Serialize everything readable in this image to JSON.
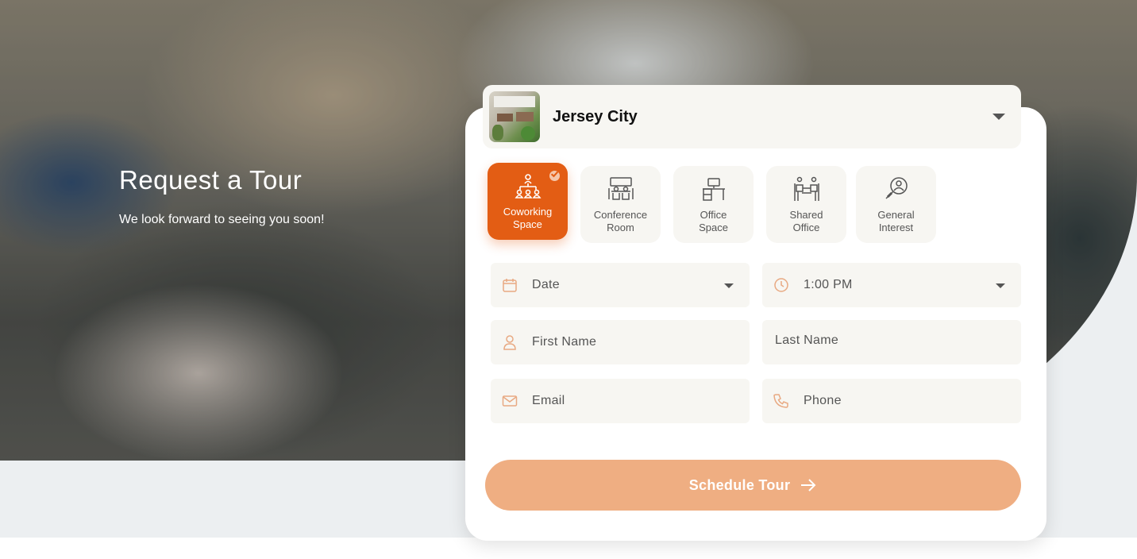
{
  "hero": {
    "title": "Request a Tour",
    "subtitle": "We look forward to seeing you soon!"
  },
  "location": {
    "selected": "Jersey City",
    "icon": "chevron-down-icon"
  },
  "space_types": [
    {
      "label": "Coworking Space",
      "icon": "coworking-icon",
      "selected": true
    },
    {
      "label": "Conference Room",
      "icon": "conference-room-icon",
      "selected": false
    },
    {
      "label": "Office Space",
      "icon": "office-desk-icon",
      "selected": false
    },
    {
      "label": "Shared Office",
      "icon": "shared-office-icon",
      "selected": false
    },
    {
      "label": "General Interest",
      "icon": "search-person-icon",
      "selected": false
    }
  ],
  "form": {
    "date": {
      "placeholder": "Date",
      "icon": "calendar-icon"
    },
    "time": {
      "value": "1:00 PM",
      "icon": "clock-icon"
    },
    "first_name": {
      "placeholder": "First Name",
      "icon": "user-icon"
    },
    "last_name": {
      "placeholder": "Last Name"
    },
    "email": {
      "placeholder": "Email",
      "icon": "mail-icon"
    },
    "phone": {
      "placeholder": "Phone",
      "icon": "phone-icon"
    }
  },
  "submit": {
    "label": "Schedule Tour",
    "icon": "arrow-right-icon"
  },
  "colors": {
    "accent": "#e35d14",
    "accent_soft": "#efae82",
    "field_bg": "#f7f6f2",
    "icon": "#e8a982"
  }
}
